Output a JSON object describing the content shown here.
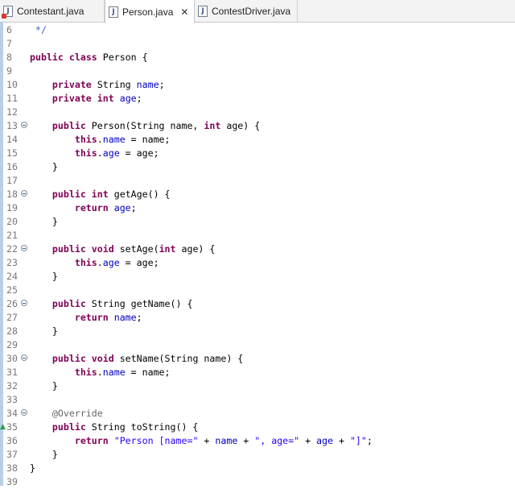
{
  "tabs": [
    {
      "label": "Contestant.java",
      "active": false,
      "warning": true
    },
    {
      "label": "Person.java",
      "active": true,
      "close": "✕"
    },
    {
      "label": "ContestDriver.java",
      "active": false
    }
  ],
  "editor": {
    "lines": [
      {
        "n": "6",
        "tokens": [
          {
            "t": " */",
            "c": "cmt"
          }
        ]
      },
      {
        "n": "7",
        "tokens": []
      },
      {
        "n": "8",
        "tokens": [
          {
            "t": "public",
            "c": "kw"
          },
          {
            "t": " "
          },
          {
            "t": "class",
            "c": "kw"
          },
          {
            "t": " Person {"
          }
        ]
      },
      {
        "n": "9",
        "tokens": []
      },
      {
        "n": "10",
        "tokens": [
          {
            "t": "    "
          },
          {
            "t": "private",
            "c": "kw"
          },
          {
            "t": " String "
          },
          {
            "t": "name",
            "c": "fld"
          },
          {
            "t": ";"
          }
        ]
      },
      {
        "n": "11",
        "tokens": [
          {
            "t": "    "
          },
          {
            "t": "private",
            "c": "kw"
          },
          {
            "t": " "
          },
          {
            "t": "int",
            "c": "kw"
          },
          {
            "t": " "
          },
          {
            "t": "age",
            "c": "fld"
          },
          {
            "t": ";"
          }
        ]
      },
      {
        "n": "12",
        "tokens": []
      },
      {
        "n": "13",
        "fold": true,
        "tokens": [
          {
            "t": "    "
          },
          {
            "t": "public",
            "c": "kw"
          },
          {
            "t": " Person(String name, "
          },
          {
            "t": "int",
            "c": "kw"
          },
          {
            "t": " age) {"
          }
        ]
      },
      {
        "n": "14",
        "tokens": [
          {
            "t": "        "
          },
          {
            "t": "this",
            "c": "kw"
          },
          {
            "t": "."
          },
          {
            "t": "name",
            "c": "fld"
          },
          {
            "t": " = name;"
          }
        ]
      },
      {
        "n": "15",
        "tokens": [
          {
            "t": "        "
          },
          {
            "t": "this",
            "c": "kw"
          },
          {
            "t": "."
          },
          {
            "t": "age",
            "c": "fld"
          },
          {
            "t": " = age;"
          }
        ]
      },
      {
        "n": "16",
        "tokens": [
          {
            "t": "    }"
          }
        ]
      },
      {
        "n": "17",
        "tokens": []
      },
      {
        "n": "18",
        "fold": true,
        "tokens": [
          {
            "t": "    "
          },
          {
            "t": "public",
            "c": "kw"
          },
          {
            "t": " "
          },
          {
            "t": "int",
            "c": "kw"
          },
          {
            "t": " getAge() {"
          }
        ]
      },
      {
        "n": "19",
        "tokens": [
          {
            "t": "        "
          },
          {
            "t": "return",
            "c": "kw"
          },
          {
            "t": " "
          },
          {
            "t": "age",
            "c": "fld"
          },
          {
            "t": ";"
          }
        ]
      },
      {
        "n": "20",
        "tokens": [
          {
            "t": "    }"
          }
        ]
      },
      {
        "n": "21",
        "tokens": []
      },
      {
        "n": "22",
        "fold": true,
        "tokens": [
          {
            "t": "    "
          },
          {
            "t": "public",
            "c": "kw"
          },
          {
            "t": " "
          },
          {
            "t": "void",
            "c": "kw"
          },
          {
            "t": " setAge("
          },
          {
            "t": "int",
            "c": "kw"
          },
          {
            "t": " age) {"
          }
        ]
      },
      {
        "n": "23",
        "tokens": [
          {
            "t": "        "
          },
          {
            "t": "this",
            "c": "kw"
          },
          {
            "t": "."
          },
          {
            "t": "age",
            "c": "fld"
          },
          {
            "t": " = age;"
          }
        ]
      },
      {
        "n": "24",
        "tokens": [
          {
            "t": "    }"
          }
        ]
      },
      {
        "n": "25",
        "tokens": []
      },
      {
        "n": "26",
        "fold": true,
        "tokens": [
          {
            "t": "    "
          },
          {
            "t": "public",
            "c": "kw"
          },
          {
            "t": " String getName() {"
          }
        ]
      },
      {
        "n": "27",
        "tokens": [
          {
            "t": "        "
          },
          {
            "t": "return",
            "c": "kw"
          },
          {
            "t": " "
          },
          {
            "t": "name",
            "c": "fld"
          },
          {
            "t": ";"
          }
        ]
      },
      {
        "n": "28",
        "tokens": [
          {
            "t": "    }"
          }
        ]
      },
      {
        "n": "29",
        "tokens": []
      },
      {
        "n": "30",
        "fold": true,
        "tokens": [
          {
            "t": "    "
          },
          {
            "t": "public",
            "c": "kw"
          },
          {
            "t": " "
          },
          {
            "t": "void",
            "c": "kw"
          },
          {
            "t": " setName(String name) {"
          }
        ]
      },
      {
        "n": "31",
        "tokens": [
          {
            "t": "        "
          },
          {
            "t": "this",
            "c": "kw"
          },
          {
            "t": "."
          },
          {
            "t": "name",
            "c": "fld"
          },
          {
            "t": " = name;"
          }
        ]
      },
      {
        "n": "32",
        "tokens": [
          {
            "t": "    }"
          }
        ]
      },
      {
        "n": "33",
        "tokens": []
      },
      {
        "n": "34",
        "fold": true,
        "tokens": [
          {
            "t": "    "
          },
          {
            "t": "@Override",
            "c": "ann"
          }
        ]
      },
      {
        "n": "35",
        "override": true,
        "tokens": [
          {
            "t": "    "
          },
          {
            "t": "public",
            "c": "kw"
          },
          {
            "t": " String toString() {"
          }
        ]
      },
      {
        "n": "36",
        "tokens": [
          {
            "t": "        "
          },
          {
            "t": "return",
            "c": "kw"
          },
          {
            "t": " "
          },
          {
            "t": "\"Person [name=\"",
            "c": "str"
          },
          {
            "t": " + "
          },
          {
            "t": "name",
            "c": "fld"
          },
          {
            "t": " + "
          },
          {
            "t": "\", age=\"",
            "c": "str"
          },
          {
            "t": " + "
          },
          {
            "t": "age",
            "c": "fld"
          },
          {
            "t": " + "
          },
          {
            "t": "\"]\"",
            "c": "str"
          },
          {
            "t": ";"
          }
        ]
      },
      {
        "n": "37",
        "tokens": [
          {
            "t": "    }"
          }
        ]
      },
      {
        "n": "38",
        "tokens": [
          {
            "t": "}"
          }
        ]
      },
      {
        "n": "39",
        "tokens": []
      }
    ]
  },
  "colors": {
    "keyword": "#7f0055",
    "field": "#0000c0",
    "string": "#2a00ff",
    "annotation": "#646464",
    "comment": "#3f5fbf",
    "ruler": "#b8cfe6"
  }
}
